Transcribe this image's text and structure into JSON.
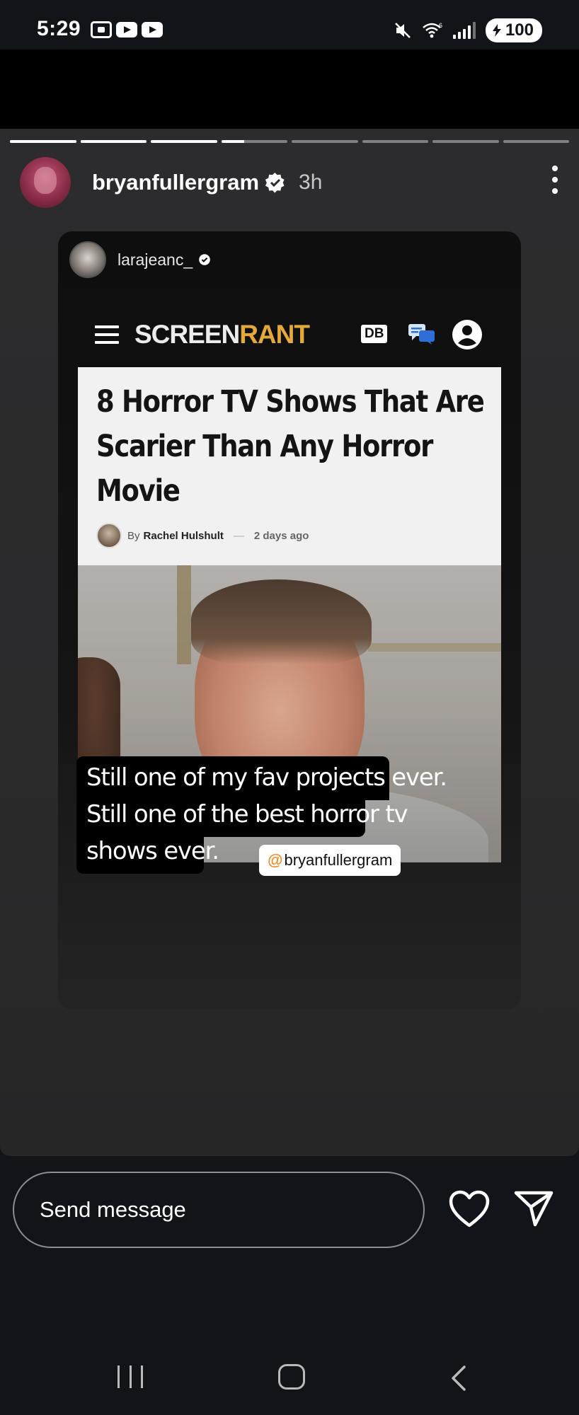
{
  "status_bar": {
    "time": "5:29",
    "battery": "100",
    "network": "6"
  },
  "story": {
    "progress": {
      "segments": 8,
      "completed": 3,
      "current_fraction": 0.35
    },
    "username": "bryanfullergram",
    "verified": true,
    "time_ago": "3h"
  },
  "shared_post": {
    "username": "larajeanc_",
    "verified": true,
    "site": {
      "brand_part1": "SCREEN",
      "brand_part2": "RANT",
      "db_badge": "DB",
      "brand_color": "#e3a93a"
    },
    "article": {
      "title": "8 Horror TV Shows That Are Scarier Than Any Horror Movie",
      "by": "By",
      "author": "Rachel Hulshult",
      "dash": "—",
      "date": "2 days ago"
    }
  },
  "caption": {
    "line1": "Still one of my fav projects ever.",
    "line2": "Still one of the best horror tv",
    "line3": "shows ever."
  },
  "mention": {
    "at": "@",
    "handle": "bryanfullergram"
  },
  "reply": {
    "placeholder": "Send message"
  },
  "icons": {
    "more": "more-vertical-icon",
    "heart": "heart-icon",
    "send": "send-icon",
    "menu": "hamburger-menu-icon",
    "chat": "chat-bubbles-icon",
    "account": "account-icon"
  }
}
